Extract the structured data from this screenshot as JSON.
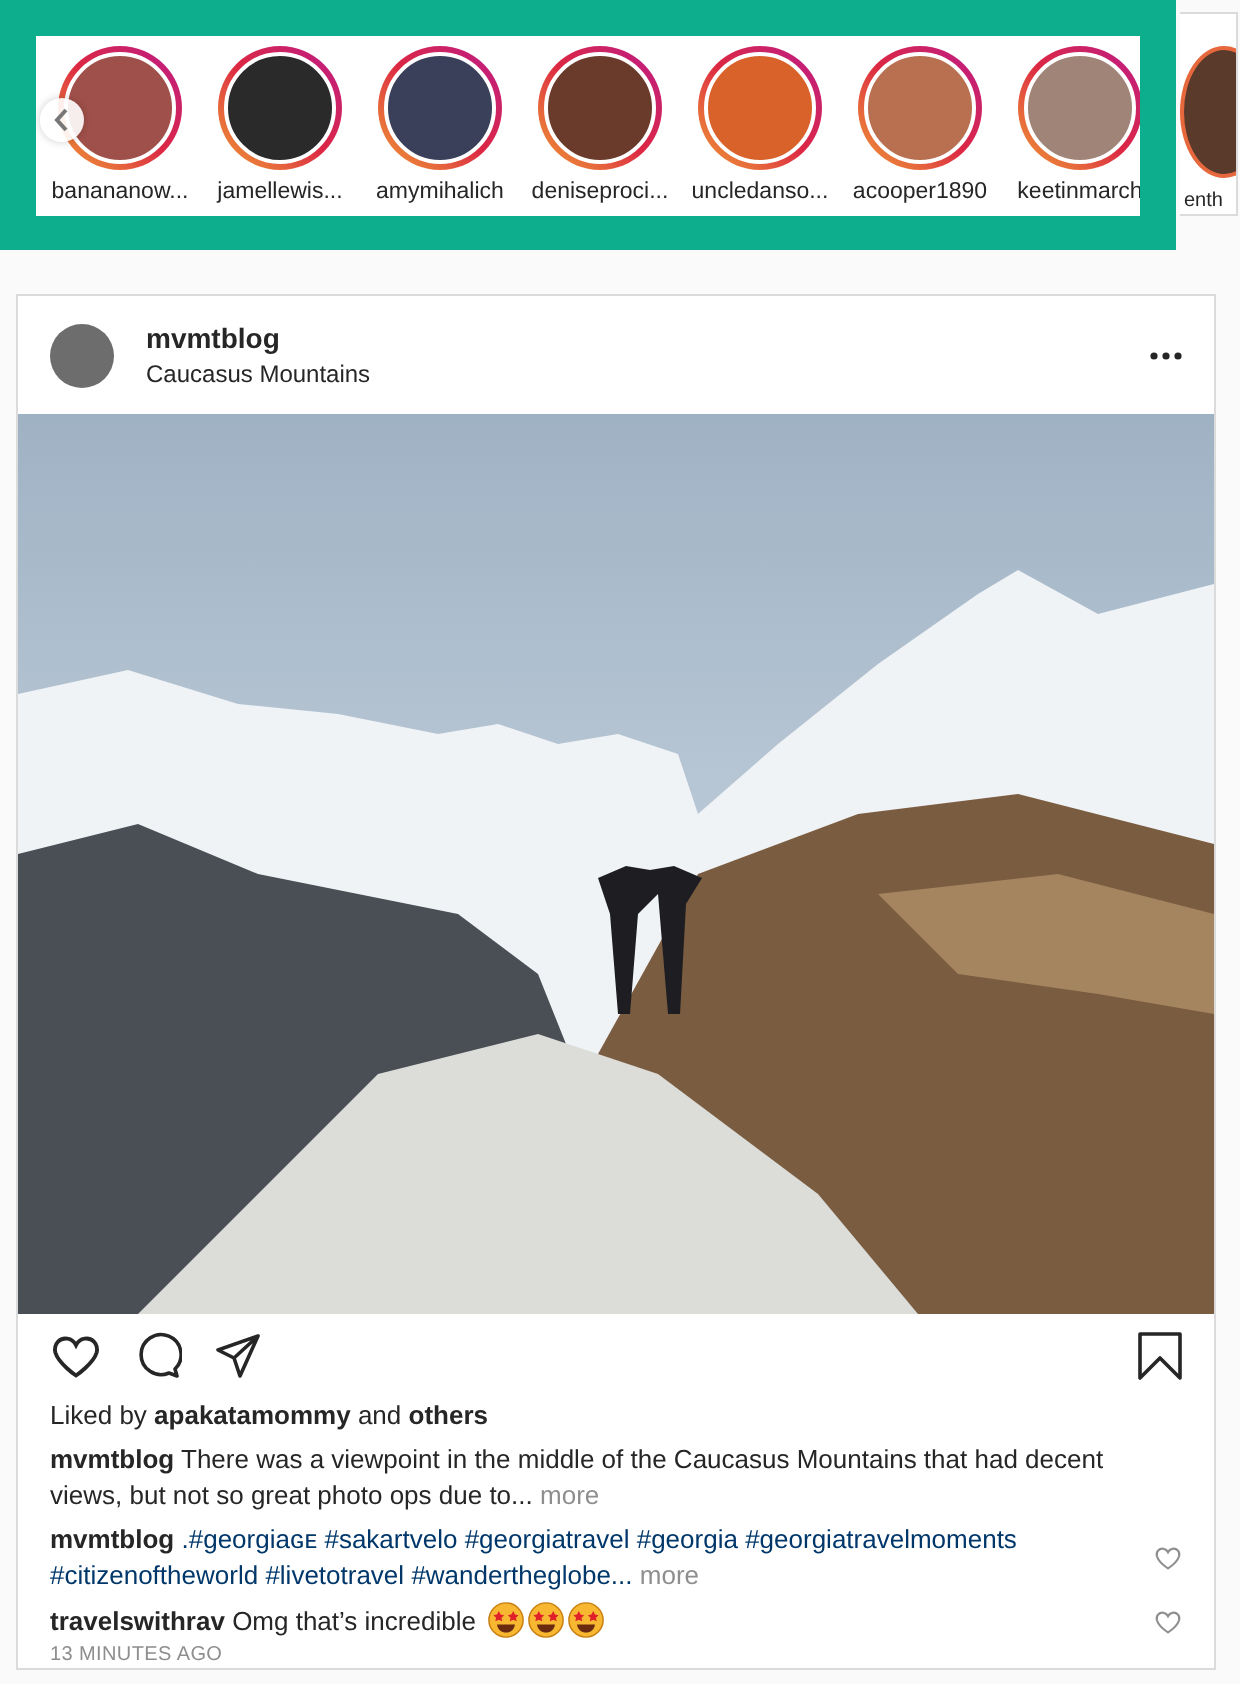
{
  "stories": [
    {
      "username": "banananow..."
    },
    {
      "username": "jamellewis..."
    },
    {
      "username": "amymihalich"
    },
    {
      "username": "deniseproci..."
    },
    {
      "username": "uncledanso..."
    },
    {
      "username": "acooper1890"
    },
    {
      "username": "keetinmarch"
    },
    {
      "username": "enth"
    }
  ],
  "post": {
    "user": "mvmtblog",
    "location": "Caucasus Mountains",
    "likes": "Liked by **apakatamommy** and **others**",
    "caption": {
      "user": "mvmtblog",
      "text": "There was a viewpoint in the middle of the Caucasus Mountains that had decent views, but not so great photo ops due to...",
      "more": "more"
    },
    "comments": [
      {
        "user": "mvmtblog",
        "parts": [
          {
            "kind": "tag",
            "text": ".#georgiaɢᴇ"
          },
          {
            "kind": "tag",
            "text": "#sakartvelo"
          },
          {
            "kind": "tag",
            "text": "#georgiatravel"
          },
          {
            "kind": "tag",
            "text": " #georgia"
          },
          {
            "kind": "tag",
            "text": "#georgiatravelmoments"
          },
          {
            "kind": "tag",
            "text": "#citizenoftheworld"
          },
          {
            "kind": "tag",
            "text": "#livetotravel"
          },
          {
            "kind": "tag",
            "text": "#wandertheglobe..."
          },
          {
            "kind": "more",
            "text": "more"
          }
        ]
      },
      {
        "user": "travelswithrav",
        "parts": [
          {
            "kind": "text",
            "text": "Omg that’s incredible"
          }
        ],
        "emojis": [
          {
            "kind": "star_eyes"
          },
          {
            "kind": "star_eyes"
          },
          {
            "kind": "star_eyes"
          }
        ]
      }
    ],
    "time": "13 MINUTES AGO"
  }
}
